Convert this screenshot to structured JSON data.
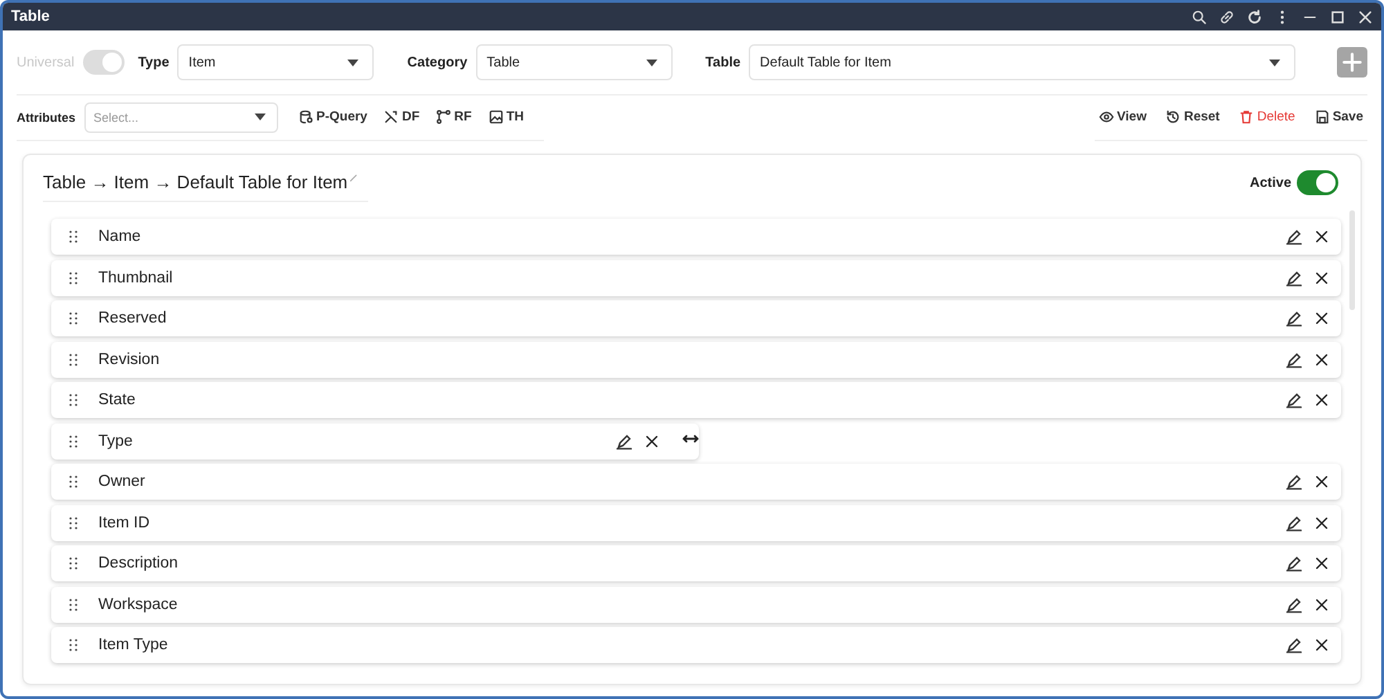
{
  "window": {
    "title": "Table"
  },
  "universal": {
    "label": "Universal",
    "on": true,
    "disabled": true
  },
  "filters": [
    {
      "label": "Type",
      "value": "Item"
    },
    {
      "label": "Category",
      "value": "Table"
    },
    {
      "label": "Table",
      "value": "Default Table for Item"
    }
  ],
  "attributes": {
    "label": "Attributes",
    "placeholder": "Select..."
  },
  "tools": [
    {
      "kind": "query",
      "label": "P-Query"
    },
    {
      "kind": "df",
      "label": "DF"
    },
    {
      "kind": "rf",
      "label": "RF"
    },
    {
      "kind": "th",
      "label": "TH"
    }
  ],
  "actions": [
    {
      "kind": "view",
      "label": "View"
    },
    {
      "kind": "reset",
      "label": "Reset"
    },
    {
      "kind": "delete",
      "label": "Delete"
    },
    {
      "kind": "save",
      "label": "Save"
    }
  ],
  "card": {
    "title": "Table → Item → Default Table for Item",
    "active_label": "Active",
    "active": true
  },
  "rows": [
    {
      "label": "Name",
      "resizing": false
    },
    {
      "label": "Thumbnail",
      "resizing": false
    },
    {
      "label": "Reserved",
      "resizing": false
    },
    {
      "label": "Revision",
      "resizing": false
    },
    {
      "label": "State",
      "resizing": false
    },
    {
      "label": "Type",
      "resizing": true
    },
    {
      "label": "Owner",
      "resizing": false
    },
    {
      "label": "Item ID",
      "resizing": false
    },
    {
      "label": "Description",
      "resizing": false
    },
    {
      "label": "Workspace",
      "resizing": false
    },
    {
      "label": "Item Type",
      "resizing": false
    }
  ]
}
